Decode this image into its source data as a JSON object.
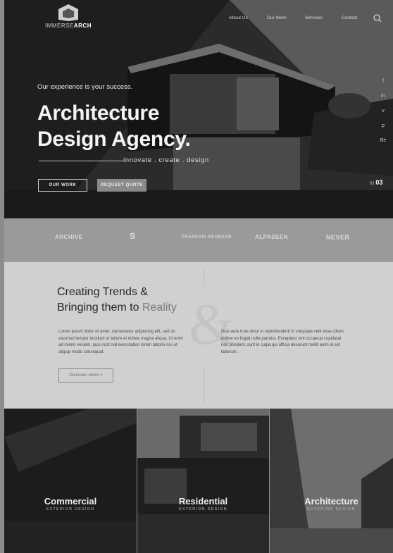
{
  "brand": {
    "prefix": "IMMERSE",
    "suffix": "ARCH"
  },
  "nav": {
    "items": [
      "About Us",
      "Our Work",
      "Services",
      "Contact"
    ]
  },
  "hero": {
    "tagline": "Our experience is your success.",
    "headline_line1": "Architecture",
    "headline_line2": "Design Agency.",
    "subline": "innovate . create . design",
    "btn_primary": "OUR WORK",
    "btn_secondary": "REQUEST QUOTE",
    "slide_current": "01",
    "slide_total": "03",
    "social": [
      "f",
      "in",
      "v",
      "p",
      "Be"
    ]
  },
  "clients": [
    "ARCHIVE",
    "S",
    "FRANCOIS REGNEAR",
    "ALPASEEN",
    "NEVER"
  ],
  "about": {
    "title_line1": "Creating Trends &",
    "title_line2_a": "Bringing them to ",
    "title_line2_b": "Reality",
    "ampersand": "&",
    "para1": "Lorem ipsum dolor sit amet, consectetur adipiscing elit, sed do eiusmod tempor incidunt ut labore et dolore magna aliqua. Ut enim ad minim veniam, quis nost rud exercitation lorem laboris nisi ut aliquip modo consequat.",
    "para2": "Duis aute irure dolor in reprehenderit in voluptate velit esse cillum dolore eu fugiat nulla pariatur. Excepteur sint occaecat cupidatat non proident, sunt in culpa qui officia deserunt mollit anim id est laborum.",
    "discover": "Discover more +"
  },
  "cards": [
    {
      "title": "Commercial",
      "subtitle": "EXTERIOR DESIGN"
    },
    {
      "title": "Residential",
      "subtitle": "EXTERIOR DESIGN"
    },
    {
      "title": "Architecture",
      "subtitle": "EXTERIOR DESIGN"
    }
  ]
}
